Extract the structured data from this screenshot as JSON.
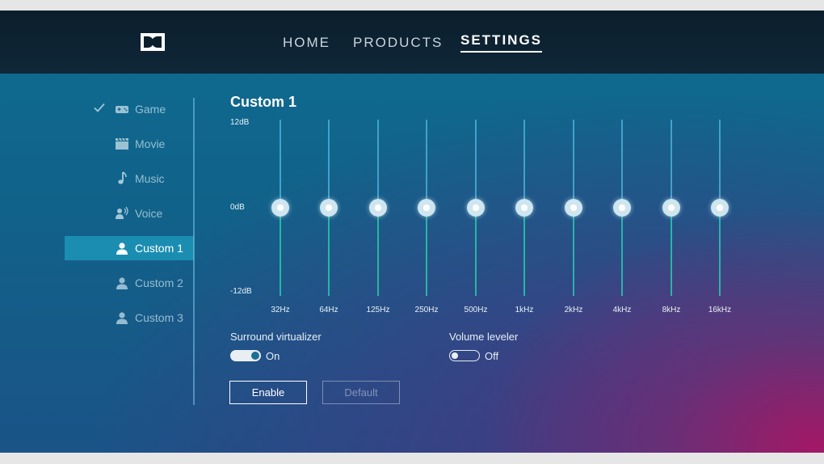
{
  "nav": {
    "items": [
      {
        "label": "HOME"
      },
      {
        "label": "PRODUCTS"
      },
      {
        "label": "SETTINGS",
        "active": true
      }
    ]
  },
  "sidebar": {
    "items": [
      {
        "label": "Game",
        "icon": "gamepad-icon",
        "checked": true
      },
      {
        "label": "Movie",
        "icon": "clapperboard-icon"
      },
      {
        "label": "Music",
        "icon": "music-note-icon"
      },
      {
        "label": "Voice",
        "icon": "voice-icon"
      },
      {
        "label": "Custom 1",
        "icon": "person-icon",
        "selected": true
      },
      {
        "label": "Custom 2",
        "icon": "person-icon"
      },
      {
        "label": "Custom 3",
        "icon": "person-icon"
      }
    ]
  },
  "equalizer": {
    "title": "Custom 1",
    "db_max": "12dB",
    "db_mid": "0dB",
    "db_min": "-12dB",
    "bands": [
      {
        "freq": "32Hz",
        "gain_db": 0
      },
      {
        "freq": "64Hz",
        "gain_db": 0
      },
      {
        "freq": "125Hz",
        "gain_db": 0
      },
      {
        "freq": "250Hz",
        "gain_db": 0
      },
      {
        "freq": "500Hz",
        "gain_db": 0
      },
      {
        "freq": "1kHz",
        "gain_db": 0
      },
      {
        "freq": "2kHz",
        "gain_db": 0
      },
      {
        "freq": "4kHz",
        "gain_db": 0
      },
      {
        "freq": "8kHz",
        "gain_db": 0
      },
      {
        "freq": "16kHz",
        "gain_db": 0
      }
    ]
  },
  "options": {
    "surround": {
      "label": "Surround virtualizer",
      "state": "On"
    },
    "leveler": {
      "label": "Volume leveler",
      "state": "Off"
    }
  },
  "buttons": {
    "enable": "Enable",
    "default": "Default"
  },
  "colors": {
    "accent": "#1b8db1",
    "topbar": "#0b1e2c"
  }
}
